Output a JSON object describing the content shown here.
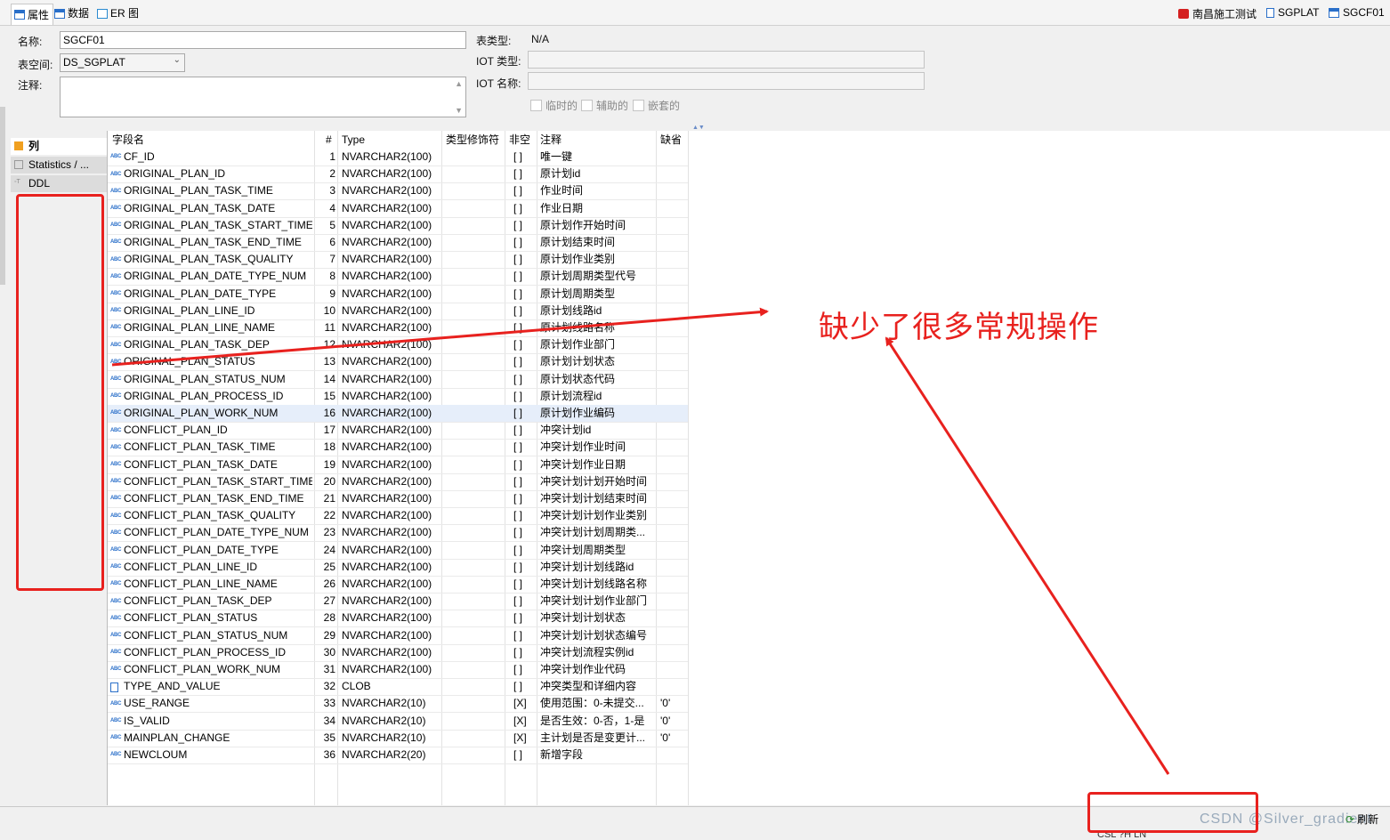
{
  "tabs": [
    {
      "label": "属性",
      "active": true
    },
    {
      "label": "数据",
      "active": false
    },
    {
      "label": "ER 图",
      "active": false
    }
  ],
  "breadcrumb": {
    "connection": "南昌施工测试",
    "schema": "SGPLAT",
    "table": "SGCF01"
  },
  "props": {
    "name_label": "名称:",
    "name_value": "SGCF01",
    "tablespace_label": "表空间:",
    "tablespace_value": "DS_SGPLAT",
    "comment_label": "注释:",
    "table_type_label": "表类型:",
    "table_type_value": "N/A",
    "iot_type_label": "IOT 类型:",
    "iot_name_label": "IOT 名称:",
    "temp_label": "临时的",
    "aux_label": "辅助的",
    "nested_label": "嵌套的"
  },
  "leftnav": {
    "columns": "列",
    "statistics": "Statistics / ...",
    "ddl": "DDL"
  },
  "columns_header": {
    "name": "字段名",
    "num": "#",
    "type": "Type",
    "modifier": "类型修饰符",
    "notnull": "非空",
    "comment": "注释",
    "default": "缺省"
  },
  "rows": [
    {
      "name": "CF_ID",
      "num": "1",
      "type": "NVARCHAR2(100)",
      "notnull": "[ ]",
      "comment": "唯一键",
      "default": "",
      "icon": "abc"
    },
    {
      "name": "ORIGINAL_PLAN_ID",
      "num": "2",
      "type": "NVARCHAR2(100)",
      "notnull": "[ ]",
      "comment": "原计划id",
      "default": "",
      "icon": "abc"
    },
    {
      "name": "ORIGINAL_PLAN_TASK_TIME",
      "num": "3",
      "type": "NVARCHAR2(100)",
      "notnull": "[ ]",
      "comment": "作业时间",
      "default": "",
      "icon": "abc"
    },
    {
      "name": "ORIGINAL_PLAN_TASK_DATE",
      "num": "4",
      "type": "NVARCHAR2(100)",
      "notnull": "[ ]",
      "comment": "作业日期",
      "default": "",
      "icon": "abc"
    },
    {
      "name": "ORIGINAL_PLAN_TASK_START_TIME",
      "num": "5",
      "type": "NVARCHAR2(100)",
      "notnull": "[ ]",
      "comment": "原计划作开始时间",
      "default": "",
      "icon": "abc"
    },
    {
      "name": "ORIGINAL_PLAN_TASK_END_TIME",
      "num": "6",
      "type": "NVARCHAR2(100)",
      "notnull": "[ ]",
      "comment": "原计划结束时间",
      "default": "",
      "icon": "abc"
    },
    {
      "name": "ORIGINAL_PLAN_TASK_QUALITY",
      "num": "7",
      "type": "NVARCHAR2(100)",
      "notnull": "[ ]",
      "comment": "原计划作业类别",
      "default": "",
      "icon": "abc"
    },
    {
      "name": "ORIGINAL_PLAN_DATE_TYPE_NUM",
      "num": "8",
      "type": "NVARCHAR2(100)",
      "notnull": "[ ]",
      "comment": "原计划周期类型代号",
      "default": "",
      "icon": "abc"
    },
    {
      "name": "ORIGINAL_PLAN_DATE_TYPE",
      "num": "9",
      "type": "NVARCHAR2(100)",
      "notnull": "[ ]",
      "comment": "原计划周期类型",
      "default": "",
      "icon": "abc"
    },
    {
      "name": "ORIGINAL_PLAN_LINE_ID",
      "num": "10",
      "type": "NVARCHAR2(100)",
      "notnull": "[ ]",
      "comment": "原计划线路id",
      "default": "",
      "icon": "abc"
    },
    {
      "name": "ORIGINAL_PLAN_LINE_NAME",
      "num": "11",
      "type": "NVARCHAR2(100)",
      "notnull": "[ ]",
      "comment": "原计划线路名称",
      "default": "",
      "icon": "abc"
    },
    {
      "name": "ORIGINAL_PLAN_TASK_DEP",
      "num": "12",
      "type": "NVARCHAR2(100)",
      "notnull": "[ ]",
      "comment": "原计划作业部门",
      "default": "",
      "icon": "abc"
    },
    {
      "name": "ORIGINAL_PLAN_STATUS",
      "num": "13",
      "type": "NVARCHAR2(100)",
      "notnull": "[ ]",
      "comment": "原计划计划状态",
      "default": "",
      "icon": "abc"
    },
    {
      "name": "ORIGINAL_PLAN_STATUS_NUM",
      "num": "14",
      "type": "NVARCHAR2(100)",
      "notnull": "[ ]",
      "comment": "原计划状态代码",
      "default": "",
      "icon": "abc"
    },
    {
      "name": "ORIGINAL_PLAN_PROCESS_ID",
      "num": "15",
      "type": "NVARCHAR2(100)",
      "notnull": "[ ]",
      "comment": "原计划流程id",
      "default": "",
      "icon": "abc"
    },
    {
      "name": "ORIGINAL_PLAN_WORK_NUM",
      "num": "16",
      "type": "NVARCHAR2(100)",
      "notnull": "[ ]",
      "comment": "原计划作业编码",
      "default": "",
      "icon": "abc",
      "selected": true
    },
    {
      "name": "CONFLICT_PLAN_ID",
      "num": "17",
      "type": "NVARCHAR2(100)",
      "notnull": "[ ]",
      "comment": "冲突计划id",
      "default": "",
      "icon": "abc"
    },
    {
      "name": "CONFLICT_PLAN_TASK_TIME",
      "num": "18",
      "type": "NVARCHAR2(100)",
      "notnull": "[ ]",
      "comment": "冲突计划作业时间",
      "default": "",
      "icon": "abc"
    },
    {
      "name": "CONFLICT_PLAN_TASK_DATE",
      "num": "19",
      "type": "NVARCHAR2(100)",
      "notnull": "[ ]",
      "comment": "冲突计划作业日期",
      "default": "",
      "icon": "abc"
    },
    {
      "name": "CONFLICT_PLAN_TASK_START_TIME",
      "num": "20",
      "type": "NVARCHAR2(100)",
      "notnull": "[ ]",
      "comment": "冲突计划计划开始时间",
      "default": "",
      "icon": "abc"
    },
    {
      "name": "CONFLICT_PLAN_TASK_END_TIME",
      "num": "21",
      "type": "NVARCHAR2(100)",
      "notnull": "[ ]",
      "comment": "冲突计划计划结束时间",
      "default": "",
      "icon": "abc"
    },
    {
      "name": "CONFLICT_PLAN_TASK_QUALITY",
      "num": "22",
      "type": "NVARCHAR2(100)",
      "notnull": "[ ]",
      "comment": "冲突计划计划作业类别",
      "default": "",
      "icon": "abc"
    },
    {
      "name": "CONFLICT_PLAN_DATE_TYPE_NUM",
      "num": "23",
      "type": "NVARCHAR2(100)",
      "notnull": "[ ]",
      "comment": "冲突计划计划周期类...",
      "default": "",
      "icon": "abc"
    },
    {
      "name": "CONFLICT_PLAN_DATE_TYPE",
      "num": "24",
      "type": "NVARCHAR2(100)",
      "notnull": "[ ]",
      "comment": "冲突计划周期类型",
      "default": "",
      "icon": "abc"
    },
    {
      "name": "CONFLICT_PLAN_LINE_ID",
      "num": "25",
      "type": "NVARCHAR2(100)",
      "notnull": "[ ]",
      "comment": "冲突计划计划线路id",
      "default": "",
      "icon": "abc"
    },
    {
      "name": "CONFLICT_PLAN_LINE_NAME",
      "num": "26",
      "type": "NVARCHAR2(100)",
      "notnull": "[ ]",
      "comment": "冲突计划计划线路名称",
      "default": "",
      "icon": "abc"
    },
    {
      "name": "CONFLICT_PLAN_TASK_DEP",
      "num": "27",
      "type": "NVARCHAR2(100)",
      "notnull": "[ ]",
      "comment": "冲突计划计划作业部门",
      "default": "",
      "icon": "abc"
    },
    {
      "name": "CONFLICT_PLAN_STATUS",
      "num": "28",
      "type": "NVARCHAR2(100)",
      "notnull": "[ ]",
      "comment": "冲突计划计划状态",
      "default": "",
      "icon": "abc"
    },
    {
      "name": "CONFLICT_PLAN_STATUS_NUM",
      "num": "29",
      "type": "NVARCHAR2(100)",
      "notnull": "[ ]",
      "comment": "冲突计划计划状态编号",
      "default": "",
      "icon": "abc"
    },
    {
      "name": "CONFLICT_PLAN_PROCESS_ID",
      "num": "30",
      "type": "NVARCHAR2(100)",
      "notnull": "[ ]",
      "comment": "冲突计划流程实例id",
      "default": "",
      "icon": "abc"
    },
    {
      "name": "CONFLICT_PLAN_WORK_NUM",
      "num": "31",
      "type": "NVARCHAR2(100)",
      "notnull": "[ ]",
      "comment": "冲突计划作业代码",
      "default": "",
      "icon": "abc"
    },
    {
      "name": "TYPE_AND_VALUE",
      "num": "32",
      "type": "CLOB",
      "notnull": "[ ]",
      "comment": "冲突类型和详细内容",
      "default": "",
      "icon": "doc"
    },
    {
      "name": "USE_RANGE",
      "num": "33",
      "type": "NVARCHAR2(10)",
      "notnull": "[X]",
      "comment": "使用范围：0-未提交...",
      "default": "'0'",
      "icon": "abc"
    },
    {
      "name": "IS_VALID",
      "num": "34",
      "type": "NVARCHAR2(10)",
      "notnull": "[X]",
      "comment": "是否生效：0-否，1-是",
      "default": "'0'",
      "icon": "abc"
    },
    {
      "name": "MAINPLAN_CHANGE",
      "num": "35",
      "type": "NVARCHAR2(10)",
      "notnull": "[X]",
      "comment": "主计划是否是变更计...",
      "default": "'0'",
      "icon": "abc"
    },
    {
      "name": "NEWCLOUM",
      "num": "36",
      "type": "NVARCHAR2(20)",
      "notnull": "[ ]",
      "comment": "新增字段",
      "default": "",
      "icon": "abc"
    }
  ],
  "annotation": "缺少了很多常规操作",
  "bottombar": {
    "refresh": "刷新",
    "watermark": "CSDN @Silver_gradient",
    "cut": "CSL  ?H LN"
  },
  "colors": {
    "annotation_red": "#e8211e",
    "selected_row": "#e6eefa",
    "icon_blue": "#2a6fc9"
  }
}
